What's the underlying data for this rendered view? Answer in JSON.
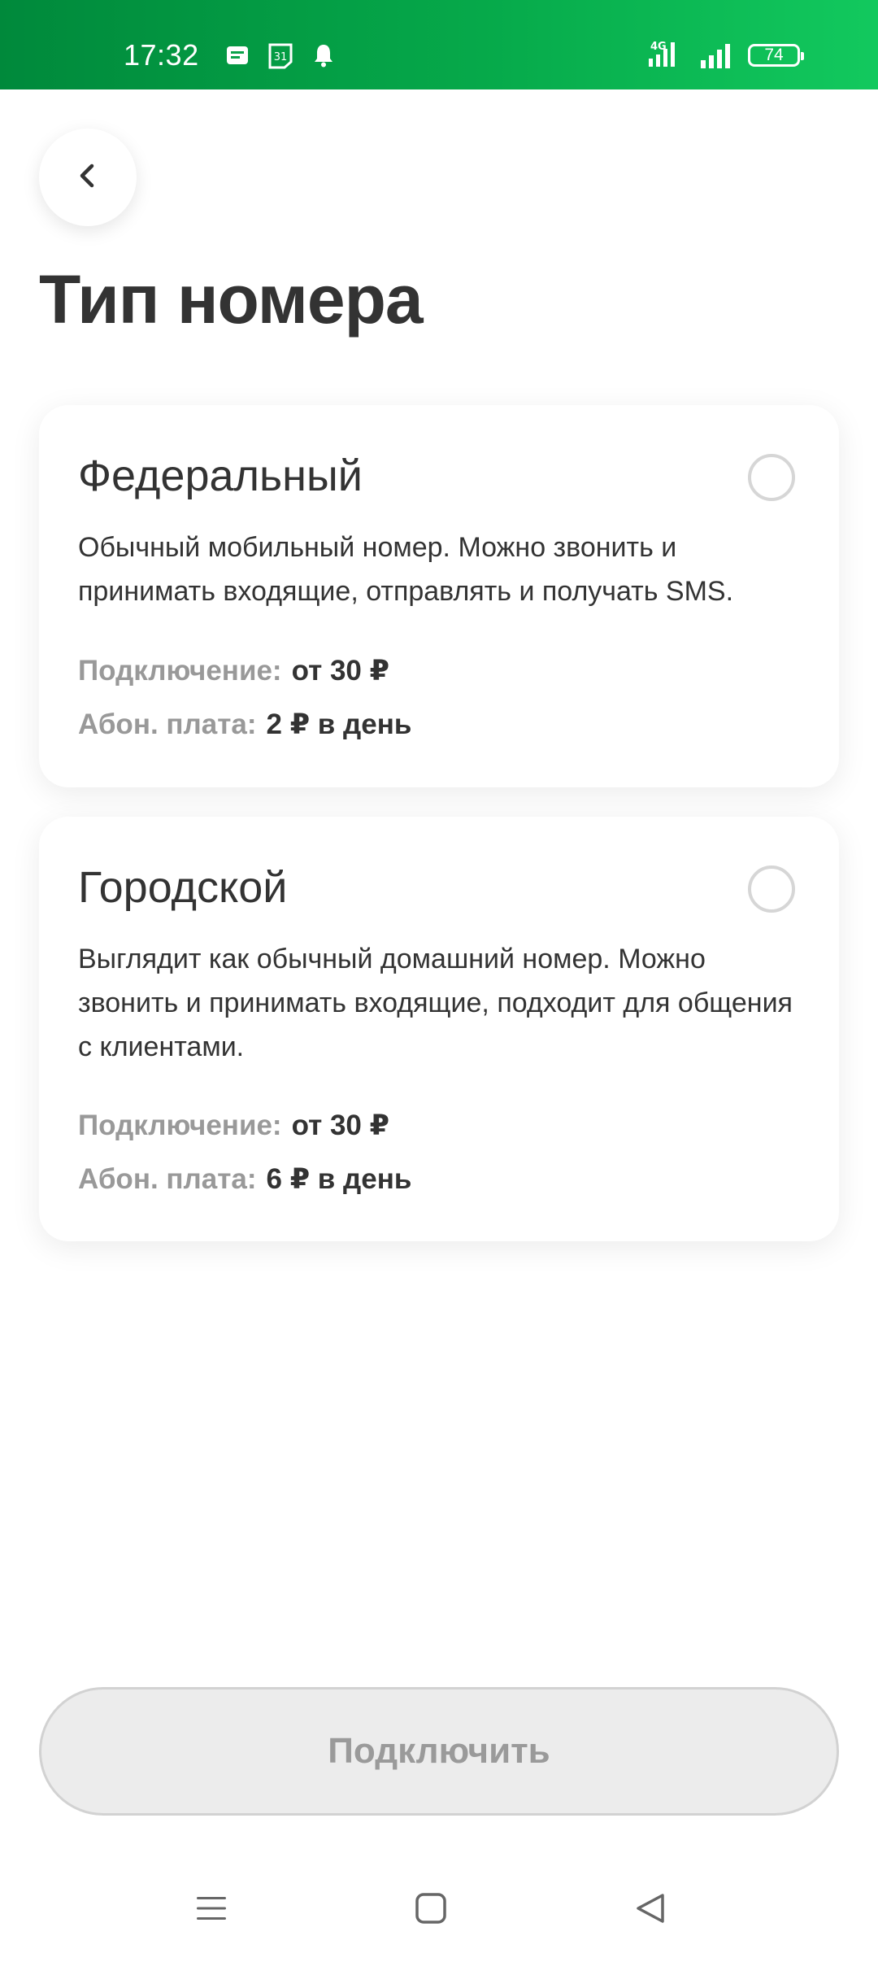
{
  "status_bar": {
    "time": "17:32",
    "icons": [
      "message-notification-icon",
      "calendar-icon",
      "bell-icon"
    ],
    "network_label": "4G",
    "battery_level": "74"
  },
  "back_button": {
    "icon": "chevron-left-icon"
  },
  "page": {
    "title": "Тип номера"
  },
  "options": [
    {
      "title": "Федеральный",
      "description": "Обычный мобильный номер. Можно звонить и принимать входящие, отправлять и получать SMS.",
      "connect_label": "Подключение:",
      "connect_value": "от 30 ₽",
      "fee_label": "Абон. плата:",
      "fee_value": "2 ₽ в день",
      "selected": false
    },
    {
      "title": "Городской",
      "description": "Выглядит как обычный домашний номер. Можно звонить и принимать входящие, подходит для общения с клиентами.",
      "connect_label": "Подключение:",
      "connect_value": "от 30 ₽",
      "fee_label": "Абон. плата:",
      "fee_value": "6 ₽ в день",
      "selected": false
    }
  ],
  "connect_button": {
    "label": "Подключить",
    "enabled": false
  },
  "nav_bar": {
    "icons": [
      "menu-icon",
      "home-icon",
      "back-triangle-icon"
    ]
  },
  "colors": {
    "status_bar_gradient_start": "#00893b",
    "status_bar_gradient_end": "#12c95e",
    "text_primary": "#333333",
    "text_secondary": "#999999",
    "button_disabled_bg": "#ececec",
    "button_disabled_text": "#9a9a9a",
    "radio_border": "#d6d6d6"
  }
}
